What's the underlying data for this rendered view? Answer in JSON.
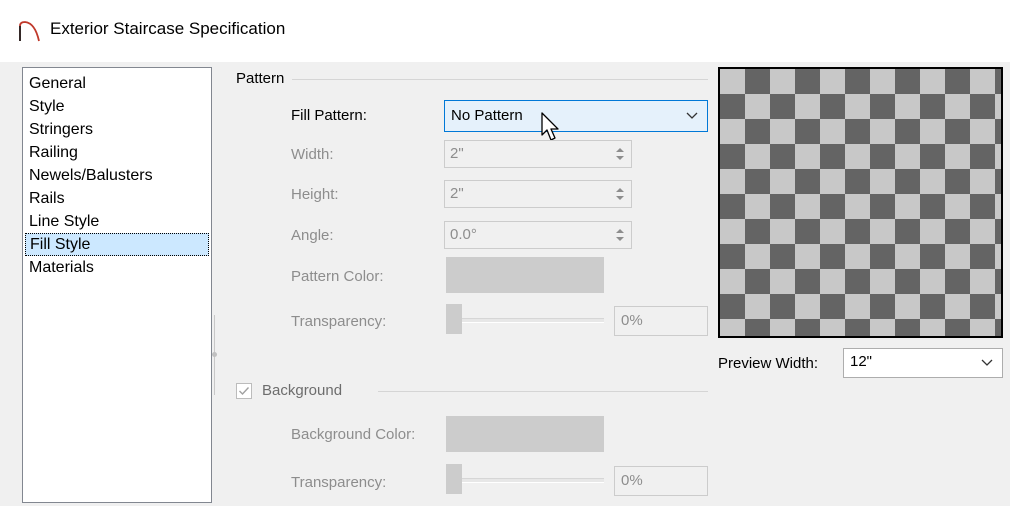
{
  "window": {
    "title": "Exterior Staircase Specification"
  },
  "nav": {
    "items": [
      {
        "label": "General"
      },
      {
        "label": "Style"
      },
      {
        "label": "Stringers"
      },
      {
        "label": "Railing"
      },
      {
        "label": "Newels/Balusters"
      },
      {
        "label": "Rails"
      },
      {
        "label": "Line Style"
      },
      {
        "label": "Fill Style",
        "selected": true
      },
      {
        "label": "Materials"
      }
    ]
  },
  "pattern": {
    "group_title": "Pattern",
    "fill_pattern": {
      "label": "Fill Pattern:",
      "value": "No Pattern"
    },
    "width": {
      "label": "Width:",
      "value": "2\""
    },
    "height": {
      "label": "Height:",
      "value": "2\""
    },
    "angle": {
      "label": "Angle:",
      "value": "0.0°"
    },
    "pattern_color": {
      "label": "Pattern Color:"
    },
    "transparency": {
      "label": "Transparency:",
      "value": "0%"
    }
  },
  "background": {
    "group_title": "Background",
    "checked": true,
    "background_color": {
      "label": "Background Color:"
    },
    "transparency": {
      "label": "Transparency:",
      "value": "0%"
    }
  },
  "preview": {
    "width_label": "Preview Width:",
    "width_value": "12\""
  },
  "colors": {
    "selection": "#cce8ff",
    "accent": "#0078d7",
    "checker_dark": "#646464",
    "checker_light": "#c8c8c8"
  },
  "icons": {
    "title": "arc-icon",
    "dropdown": "chevron-down-icon",
    "spin": "spin-arrows-icon",
    "cursor": "mouse-pointer-icon",
    "check": "checkmark-icon"
  }
}
